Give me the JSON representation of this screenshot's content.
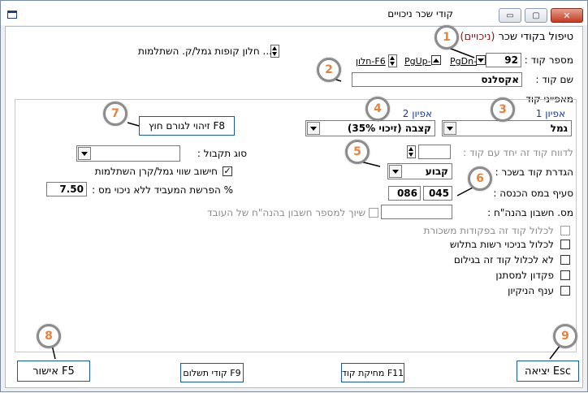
{
  "window": {
    "title": "קודי שכר ניכויים",
    "minimize_glyph": "▭",
    "maximize_glyph": "▢",
    "close_glyph": "✕"
  },
  "header": {
    "heading": "טיפול בקודי שכר",
    "heading_paren": "(ניכויים)",
    "funds_window": "חלון קופות גמל/ק. השתלמות ..."
  },
  "code_row": {
    "label": "מספר קוד :",
    "value": "92",
    "pgdn": "PgDn-",
    "pgup": "PgUp-",
    "f6": "חלון-F6"
  },
  "name_row": {
    "label": "שם קוד :",
    "value": "אקסלנס"
  },
  "characteristics": {
    "label": "מאפייני קוד",
    "option1_label": "אפיון 1",
    "option1_value": "גמל",
    "option2_label": "אפיון 2",
    "option2_value": "קצבה (זיכוי 35%)"
  },
  "buttons": {
    "identify_f8": "זיהוי לגורם חוץ F8",
    "approve_f5": "אישור F5",
    "pay_codes_f9": "קודי תשלום F9",
    "delete_f11": "מחיקת קוד F11",
    "exit_esc": "יציאה Esc"
  },
  "fields": {
    "report_together_label": "לדווח קוד זה יחד עם קוד :",
    "report_together_value": "",
    "salary_def_label": "הגדרת קוד בשכר :",
    "salary_def_value": "קבוע",
    "tax_clause_label": "סעיף במס הכנסה :",
    "tax_clause_a": "045",
    "tax_clause_b": "086",
    "acct_label": "מס. חשבון בהנה\"ח :",
    "acct_value": "",
    "acct_link_label": "שיוך למספר חשבון בהנה\"ח של העובד",
    "receive_type_label": "סוג תקבול :",
    "receive_type_value": "",
    "calc_worth_label": "חישוב שווי גמל/קרן השתלמות",
    "employer_pct_label": "% הפרשת המעביד ללא ניכוי מס :",
    "employer_pct_value": "7.50"
  },
  "checkboxes": [
    {
      "label": "לכלול קוד זה בפקודות משכורת",
      "checked": false,
      "disabled": true
    },
    {
      "label": "לכלול בניכוי רשות בתלוש",
      "checked": false,
      "disabled": false
    },
    {
      "label": "לא לכלול קוד זה בגילום",
      "checked": false,
      "disabled": false
    },
    {
      "label": "פקדון למסתנן",
      "checked": false,
      "disabled": false
    },
    {
      "label": "ענף הניקיון",
      "checked": false,
      "disabled": false
    }
  ],
  "callouts": [
    "1",
    "2",
    "3",
    "4",
    "5",
    "6",
    "7",
    "8",
    "9"
  ]
}
